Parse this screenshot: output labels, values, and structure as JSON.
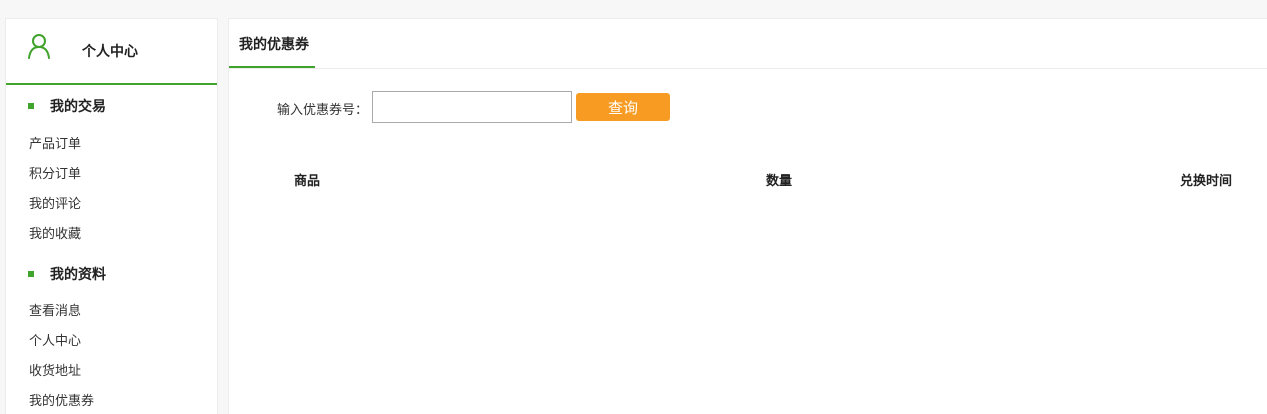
{
  "sidebar": {
    "title": "个人中心",
    "sections": [
      {
        "title": "我的交易",
        "items": [
          "产品订单",
          "积分订单",
          "我的评论",
          "我的收藏"
        ]
      },
      {
        "title": "我的资料",
        "items": [
          "查看消息",
          "个人中心",
          "收货地址",
          "我的优惠券"
        ]
      }
    ]
  },
  "main": {
    "tab": "我的优惠券",
    "coupon_label": "输入优惠券号：",
    "coupon_value": "",
    "query_button": "查询",
    "table_headers": [
      "商品",
      "数量",
      "兑换时间"
    ]
  },
  "colors": {
    "accent_green": "#3fa32c",
    "button_orange": "#f89b22"
  },
  "icons": {
    "sidebar_header": "user-icon"
  }
}
